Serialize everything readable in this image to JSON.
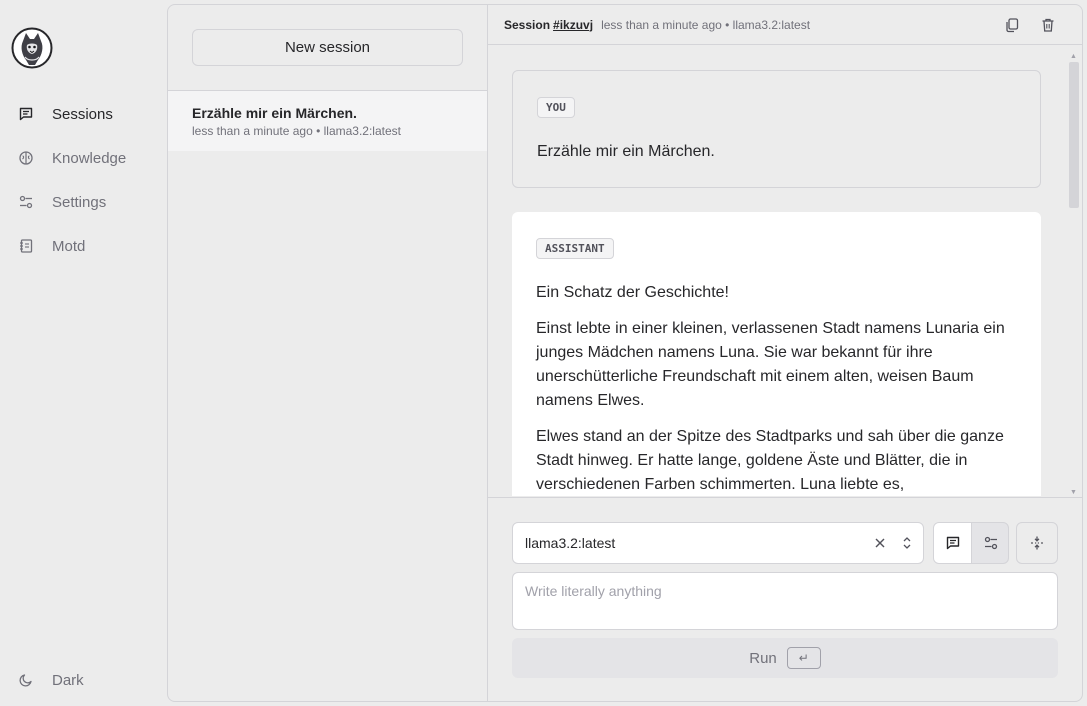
{
  "nav": {
    "items": [
      {
        "label": "Sessions",
        "icon": "message-square-icon",
        "active": true
      },
      {
        "label": "Knowledge",
        "icon": "brain-icon",
        "active": false
      },
      {
        "label": "Settings",
        "icon": "sliders-icon",
        "active": false
      },
      {
        "label": "Motd",
        "icon": "notebook-icon",
        "active": false
      }
    ],
    "theme_label": "Dark"
  },
  "sessions": {
    "new_label": "New session",
    "items": [
      {
        "title": "Erzähle mir ein Märchen.",
        "meta": "less than a minute ago • llama3.2:latest"
      }
    ]
  },
  "chat": {
    "header": {
      "session_label": "Session",
      "session_id": "#ikzuvj",
      "meta": "less than a minute ago • llama3.2:latest"
    },
    "messages": [
      {
        "role": "YOU",
        "paragraphs": [
          "Erzähle mir ein Märchen."
        ]
      },
      {
        "role": "ASSISTANT",
        "paragraphs": [
          "Ein Schatz der Geschichte!",
          "Einst lebte in einer kleinen, verlassenen Stadt namens Lunaria ein junges Mädchen namens Luna. Sie war bekannt für ihre unerschütterliche Freundschaft mit einem alten, weisen Baum namens Elwes.",
          "Elwes stand an der Spitze des Stadtparks und sah über die ganze Stadt hinweg. Er hatte lange, goldene Äste und Blätter, die in verschiedenen Farben schimmerten. Luna liebte es,"
        ]
      }
    ]
  },
  "composer": {
    "model": "llama3.2:latest",
    "placeholder": "Write literally anything",
    "run_label": "Run",
    "run_key": "↵"
  }
}
